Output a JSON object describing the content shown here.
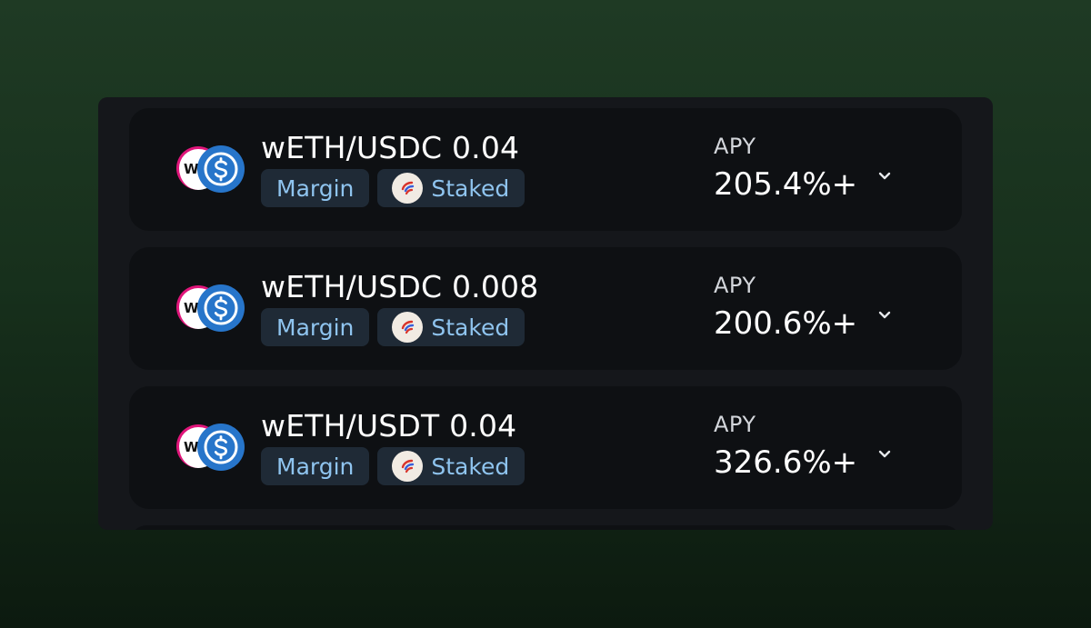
{
  "pools": [
    {
      "pair": "wETH/USDC 0.04",
      "token_a_abbr": "WE",
      "tags": {
        "margin": "Margin",
        "staked": "Staked"
      },
      "apy_label": "APY",
      "apy_value": "205.4%+"
    },
    {
      "pair": "wETH/USDC 0.008",
      "token_a_abbr": "WE",
      "tags": {
        "margin": "Margin",
        "staked": "Staked"
      },
      "apy_label": "APY",
      "apy_value": "200.6%+"
    },
    {
      "pair": "wETH/USDT 0.04",
      "token_a_abbr": "WE",
      "tags": {
        "margin": "Margin",
        "staked": "Staked"
      },
      "apy_label": "APY",
      "apy_value": "326.6%+"
    }
  ],
  "icons": {
    "token_a": "weth-token-icon",
    "token_b": "usdc-token-icon",
    "staked": "staked-protocol-icon",
    "expand": "chevron-down-icon"
  },
  "colors": {
    "background": "#1f3a24",
    "panel": "#15171b",
    "row": "#0e1013",
    "tag_bg": "#1f2a36",
    "tag_text": "#8fc4ef",
    "usdc_blue": "#2775ca",
    "weth_pink": "#e0157a"
  }
}
